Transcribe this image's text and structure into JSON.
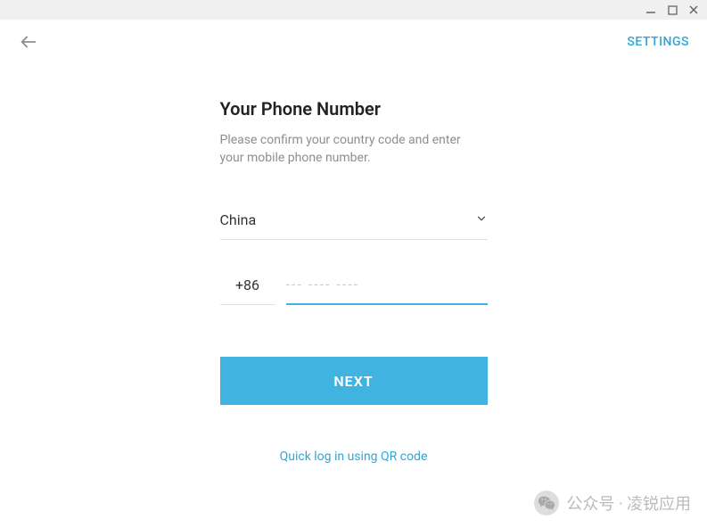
{
  "header": {
    "settings_label": "SETTINGS"
  },
  "form": {
    "title": "Your Phone Number",
    "subtitle": "Please confirm your country code and enter your mobile phone number.",
    "country": "China",
    "country_code": "+86",
    "phone_placeholder": "--- ---- ----",
    "phone_value": "",
    "next_label": "NEXT",
    "qr_link": "Quick log in using QR code"
  },
  "watermark": {
    "text": "公众号 · 凌锐应用"
  }
}
